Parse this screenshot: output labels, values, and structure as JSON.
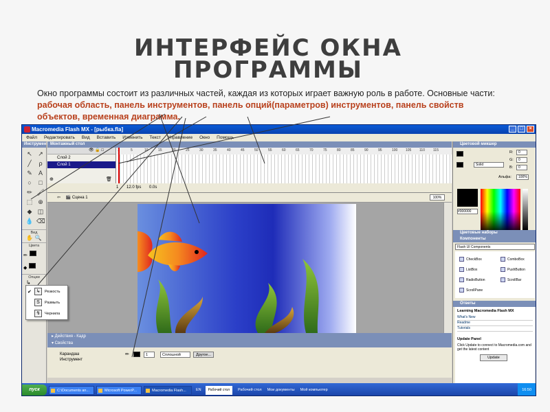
{
  "slide": {
    "title_line1": "ИНТЕРФЕЙС ОКНА",
    "title_line2": "ПРОГРАММЫ",
    "text_part1": "Окно программы состоит из различных частей, каждая из которых играет важную роль в работе. Основные части: ",
    "text_highlight": "рабочая область, панель инструментов, панель опций(параметров) инструментов, панель свойств объектов, временная диаграмма."
  },
  "window": {
    "title": "Macromedia Flash MX - [рыбка.fla]",
    "menu": [
      "Файл",
      "Редактировать",
      "Вид",
      "Вставить",
      "Изменить",
      "Текст",
      "Управление",
      "Окно",
      "Помощь"
    ],
    "controls": [
      "_",
      "□",
      "×"
    ]
  },
  "tools_panel": {
    "title": "Инструменты",
    "tools": [
      "↖",
      "↗",
      "╱",
      "ρ",
      "✎",
      "A",
      "○",
      "□",
      "✏",
      "🖌",
      "⬚",
      "⊕",
      "◆",
      "◫",
      "💧",
      "⌫"
    ],
    "view_label": "Вид",
    "colors_label": "Цвета",
    "options_label": "Опции"
  },
  "options_popup": {
    "items": [
      {
        "label": "Резкость",
        "checked": true,
        "icon": "↳"
      },
      {
        "label": "Размыть",
        "checked": false,
        "icon": "S"
      },
      {
        "label": "Чернила",
        "checked": false,
        "icon": "↯"
      }
    ]
  },
  "timeline": {
    "title": "Монтажный стол",
    "layers": [
      {
        "name": "Слой 2",
        "selected": false
      },
      {
        "name": "Слой 1",
        "selected": true
      }
    ],
    "ruler": [
      "1",
      "5",
      "10",
      "15",
      "20",
      "25",
      "30",
      "35",
      "40",
      "45",
      "50",
      "55",
      "60",
      "65",
      "70",
      "75",
      "80",
      "85",
      "90",
      "95",
      "100",
      "105",
      "110",
      "115"
    ],
    "status_frame": "1",
    "status_fps": "12.0 fps",
    "status_time": "0.0s"
  },
  "scene": {
    "label": "Сцена 1",
    "zoom": "100%"
  },
  "panels": {
    "actions": "▸ Действия - Кадр",
    "properties": "▾ Свойства",
    "tool_name_line1": "Карандаш",
    "tool_name_line2": "Инструмент",
    "stroke_width": "1",
    "stroke_style": "Сплошной",
    "custom_button": "Другое..."
  },
  "color_mixer": {
    "title": "Цветовой микшер",
    "fill_type": "Solid",
    "r_label": "R:",
    "g_label": "G:",
    "b_label": "B:",
    "r": "0",
    "g": "0",
    "b": "0",
    "alpha_label": "Альфа:",
    "alpha": "100%",
    "hex": "#000000"
  },
  "swatches_title": "Цветовые наборы",
  "components": {
    "title": "Компоненты",
    "set": "Flash UI Components",
    "items": [
      "CheckBox",
      "ComboBox",
      "ListBox",
      "PushButton",
      "RadioButton",
      "ScrollBar",
      "ScrollPane"
    ]
  },
  "answers": {
    "title": "Ответы",
    "heading": "Learning Macromedia Flash MX",
    "links": [
      "What's New",
      "Readme",
      "Tutorials"
    ],
    "update_title": "Update Panel",
    "update_text": "Click Update to connect to Macromedia.com and get the latest content",
    "update_button": "Update"
  },
  "taskbar": {
    "start": "пуск",
    "tasks": [
      "C:\\Documents an...",
      "Microsoft PowerP...",
      "Macromedia Flash..."
    ],
    "lang": "EN",
    "toolbar_item": "Рабочий стол",
    "toolbar_items": [
      "Рабочий стол",
      "Мои документы",
      "Мой компьютер"
    ],
    "clock": "16:50"
  },
  "colors": {
    "accent_text": "#b8401c",
    "title_gray": "#3e3e3e",
    "titlebar_blue": "#0a5ad6",
    "panel_header": "#7b8fb8",
    "stage_blue": "#1e2cb8"
  }
}
